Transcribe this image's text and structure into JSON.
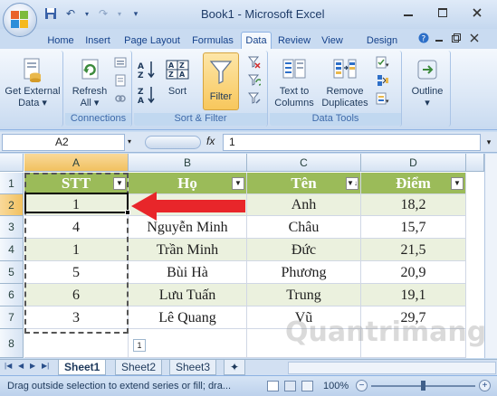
{
  "window": {
    "title": "Book1 - Microsoft Excel"
  },
  "ribbon_tabs": [
    "Home",
    "Insert",
    "Page Layout",
    "Formulas",
    "Data",
    "Review",
    "View",
    "Design"
  ],
  "active_tab": "Data",
  "ribbon": {
    "get_external": {
      "line1": "Get External",
      "line2": "Data ▾"
    },
    "refresh": {
      "line1": "Refresh",
      "line2": "All ▾"
    },
    "connections_label": "Connections",
    "sort": "Sort",
    "filter": "Filter",
    "sort_filter_label": "Sort & Filter",
    "text_to_columns": {
      "line1": "Text to",
      "line2": "Columns"
    },
    "remove_duplicates": {
      "line1": "Remove",
      "line2": "Duplicates"
    },
    "data_tools_label": "Data Tools",
    "outline": {
      "line1": "Outline",
      "line2": "▾"
    }
  },
  "formula_bar": {
    "name_box": "A2",
    "fx": "fx",
    "value": "1"
  },
  "columns": [
    "A",
    "B",
    "C",
    "D"
  ],
  "rows": [
    "1",
    "2",
    "3",
    "4",
    "5",
    "6",
    "7",
    "8"
  ],
  "table": {
    "headers": [
      "STT",
      "Họ",
      "Tên",
      "Điểm"
    ],
    "body": [
      [
        "1",
        "",
        "Anh",
        "18,2"
      ],
      [
        "4",
        "Nguyễn Minh",
        "Châu",
        "15,7"
      ],
      [
        "1",
        "Trần Minh",
        "Đức",
        "21,5"
      ],
      [
        "5",
        "Bùi Hà",
        "Phương",
        "20,9"
      ],
      [
        "6",
        "Lưu Tuấn",
        "Trung",
        "19,1"
      ],
      [
        "3",
        "Lê Quang",
        "Vũ",
        "29,7"
      ]
    ]
  },
  "sheets": [
    "Sheet1",
    "Sheet2",
    "Sheet3"
  ],
  "active_sheet": "Sheet1",
  "status": {
    "message": "Drag outside selection to extend series or fill; dra...",
    "zoom": "100%"
  },
  "watermark": "uantrimang",
  "colors": {
    "header_green": "#9bbb59",
    "band_green": "#ebf1de",
    "arrow_red": "#e8262a"
  }
}
